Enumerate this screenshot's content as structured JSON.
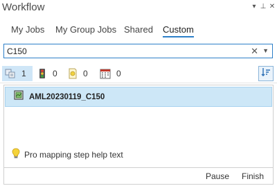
{
  "window": {
    "title": "Workflow",
    "pin_glyph": "▾",
    "pin2_glyph": "⊥",
    "close_glyph": "✕"
  },
  "tabs": [
    {
      "label": "My Jobs",
      "active": false
    },
    {
      "label": "My Group Jobs",
      "active": false
    },
    {
      "label": "Shared",
      "active": false
    },
    {
      "label": "Custom",
      "active": true
    }
  ],
  "search": {
    "value": "C150",
    "clear_glyph": "✕",
    "dropdown_glyph": "▼"
  },
  "filters": [
    {
      "icon": "jobs-icon",
      "count": "1",
      "selected": true
    },
    {
      "icon": "traffic-light-icon",
      "count": "0",
      "selected": false
    },
    {
      "icon": "pending-note-icon",
      "count": "0",
      "selected": false
    },
    {
      "icon": "calendar-icon",
      "count": "0",
      "selected": false
    }
  ],
  "sort_icon": "sort-icon",
  "jobs": [
    {
      "name": "AML20230119_C150",
      "icon": "job-map-icon"
    }
  ],
  "help": {
    "icon": "lightbulb-icon",
    "text": "Pro mapping step help text"
  },
  "footer": {
    "pause_label": "Pause",
    "finish_label": "Finish"
  },
  "colors": {
    "accent": "#2c7fc8",
    "selection": "#cde7f7"
  }
}
